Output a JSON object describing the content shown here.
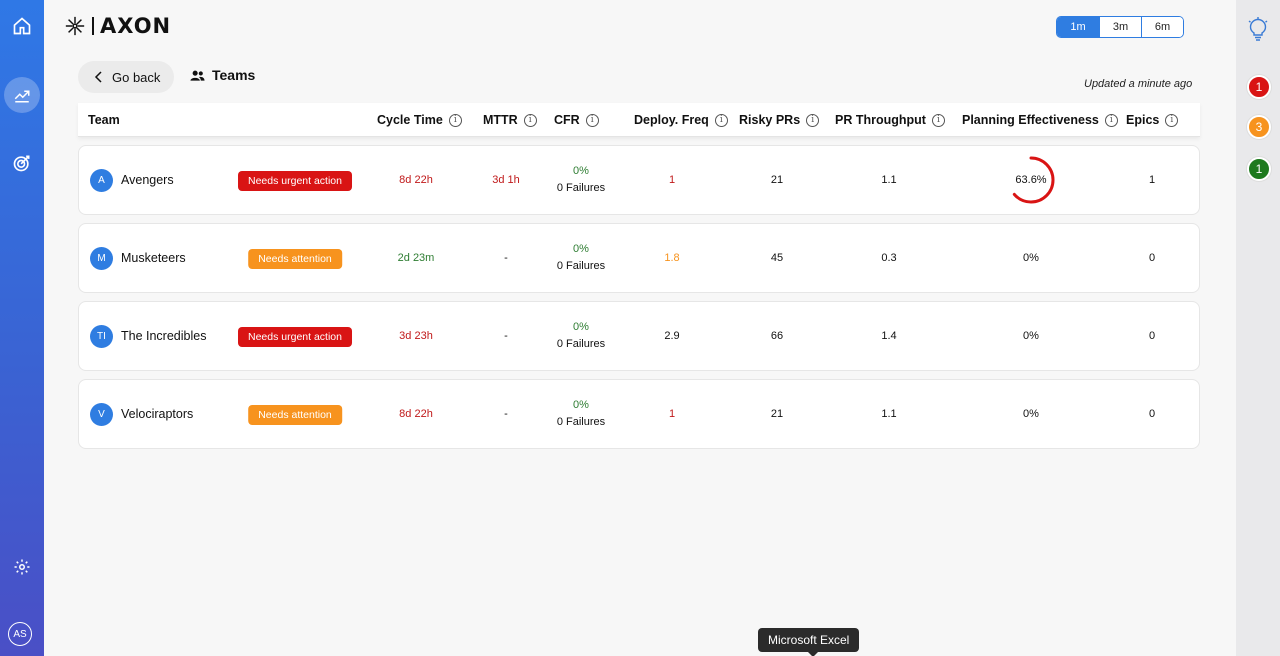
{
  "app": {
    "logo_text": "AXON"
  },
  "sidebar": {
    "user_initials": "AS"
  },
  "range": {
    "options": [
      "1m",
      "3m",
      "6m"
    ],
    "selected": "1m"
  },
  "nav": {
    "go_back": "Go back",
    "page_title": "Teams"
  },
  "updated_text": "Updated a minute ago",
  "columns": {
    "team": "Team",
    "cycle_time": "Cycle Time",
    "mttr": "MTTR",
    "cfr": "CFR",
    "deploy_freq": "Deploy. Freq",
    "risky_prs": "Risky PRs",
    "pr_throughput": "PR Throughput",
    "planning": "Planning Effectiveness",
    "epics": "Epics"
  },
  "rows": [
    {
      "initials": "A",
      "name": "Avengers",
      "status": "Needs urgent action",
      "cycle_time": "8d 22h",
      "mttr": "3d 1h",
      "cfr_pct": "0%",
      "cfr_failures": "0 Failures",
      "deploy_freq": "1",
      "risky_prs": "21",
      "pr_throughput": "1.1",
      "planning": "63.6%",
      "planning_value": 0.636,
      "epics": "1"
    },
    {
      "initials": "M",
      "name": "Musketeers",
      "status": "Needs attention",
      "cycle_time": "2d 23m",
      "mttr": "-",
      "cfr_pct": "0%",
      "cfr_failures": "0 Failures",
      "deploy_freq": "1.8",
      "risky_prs": "45",
      "pr_throughput": "0.3",
      "planning": "0%",
      "planning_value": 0,
      "epics": "0"
    },
    {
      "initials": "TI",
      "name": "The Incredibles",
      "status": "Needs urgent action",
      "cycle_time": "3d 23h",
      "mttr": "-",
      "cfr_pct": "0%",
      "cfr_failures": "0 Failures",
      "deploy_freq": "2.9",
      "risky_prs": "66",
      "pr_throughput": "1.4",
      "planning": "0%",
      "planning_value": 0,
      "epics": "0"
    },
    {
      "initials": "V",
      "name": "Velociraptors",
      "status": "Needs attention",
      "cycle_time": "8d 22h",
      "mttr": "-",
      "cfr_pct": "0%",
      "cfr_failures": "0 Failures",
      "deploy_freq": "1",
      "risky_prs": "21",
      "pr_throughput": "1.1",
      "planning": "0%",
      "planning_value": 0,
      "epics": "0"
    }
  ],
  "alerts": [
    {
      "count": "1",
      "color": "#d91414"
    },
    {
      "count": "3",
      "color": "#f7931e"
    },
    {
      "count": "1",
      "color": "#1e7a1e"
    }
  ],
  "tooltip": "Microsoft Excel",
  "colors": {
    "accent": "#2f7de1",
    "urgent": "#d91414",
    "attention": "#f7931e",
    "ring": "#d91414"
  }
}
